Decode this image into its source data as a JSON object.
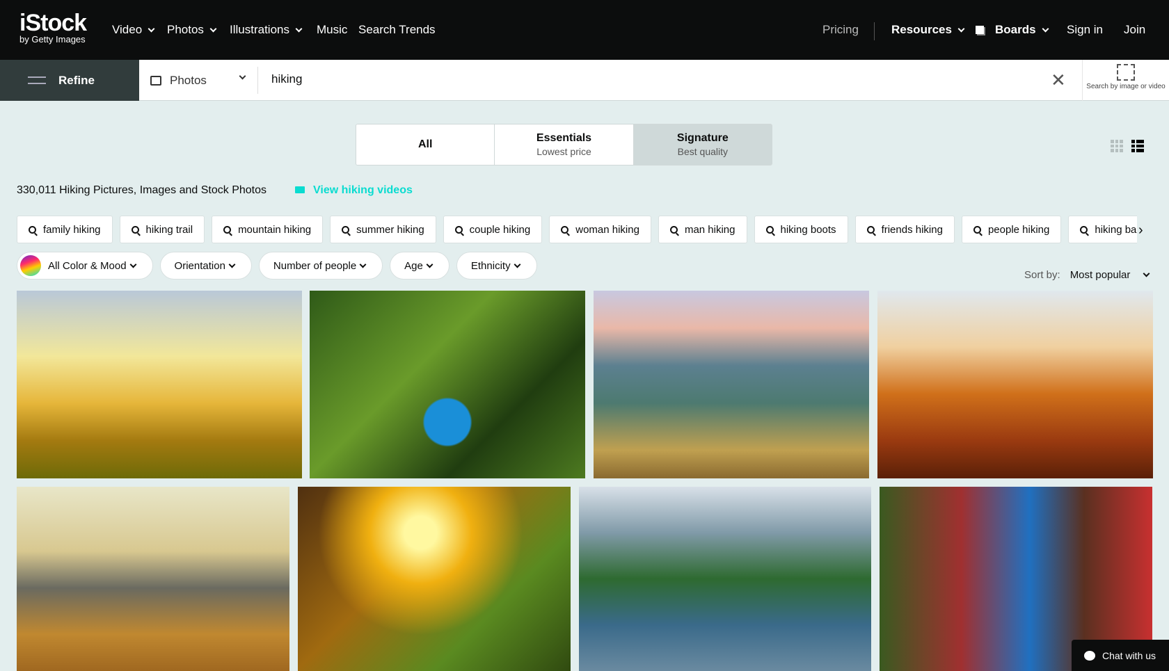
{
  "header": {
    "logo_main": "iStock",
    "logo_sub": "by Getty Images",
    "nav": [
      {
        "label": "Video",
        "dropdown": true
      },
      {
        "label": "Photos",
        "dropdown": true
      },
      {
        "label": "Illustrations",
        "dropdown": true
      },
      {
        "label": "Music"
      },
      {
        "label": "Search Trends"
      }
    ],
    "pricing": "Pricing",
    "resources": "Resources",
    "boards": "Boards",
    "sign_in": "Sign in",
    "join": "Join"
  },
  "search": {
    "refine": "Refine",
    "type": "Photos",
    "query": "hiking",
    "search_by_image": "Search by image or video"
  },
  "tabs": [
    {
      "title": "All"
    },
    {
      "title": "Essentials",
      "sub": "Lowest price"
    },
    {
      "title": "Signature",
      "sub": "Best quality",
      "selected": true
    }
  ],
  "results": {
    "count_text": "330,011 Hiking Pictures, Images and Stock Photos",
    "video_link": "View hiking videos"
  },
  "related": [
    "family hiking",
    "hiking trail",
    "mountain hiking",
    "summer hiking",
    "couple hiking",
    "woman hiking",
    "man hiking",
    "hiking boots",
    "friends hiking",
    "people hiking",
    "hiking bac"
  ],
  "filters": [
    "All Color & Mood",
    "Orientation",
    "Number of people",
    "Age",
    "Ethnicity"
  ],
  "sort": {
    "label": "Sort by:",
    "value": "Most popular"
  },
  "chat": "Chat with us",
  "colors": {
    "header": "#0c0d0d",
    "accent": "#0adcd0",
    "background": "#e3eeee"
  }
}
